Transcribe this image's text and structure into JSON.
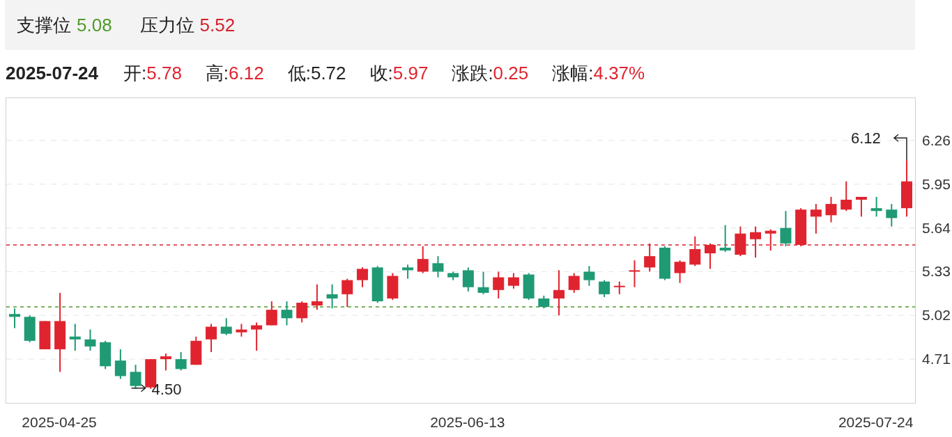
{
  "levels": [
    {
      "label": "支撑位",
      "value": "5.08",
      "color": "#4e9a2a"
    },
    {
      "label": "压力位",
      "value": "5.52",
      "color": "#d3202c"
    }
  ],
  "quote": {
    "date": "2025-07-24",
    "fields": [
      {
        "label": "开:",
        "value": "5.78",
        "color": "#e0242f"
      },
      {
        "label": "高:",
        "value": "6.12",
        "color": "#e0242f"
      },
      {
        "label": "低:",
        "value": "5.72",
        "color": "#222222"
      },
      {
        "label": "收:",
        "value": "5.97",
        "color": "#e0242f"
      },
      {
        "label": "涨跌:",
        "value": "0.25",
        "color": "#e0242f"
      },
      {
        "label": "涨幅:",
        "value": "4.37%",
        "color": "#e0242f"
      }
    ]
  },
  "chart": {
    "chart_data": {
      "type": "candlestick",
      "ohlc": [
        [
          5.03,
          5.07,
          4.93,
          5.01
        ],
        [
          5.01,
          5.02,
          4.83,
          4.84
        ],
        [
          4.78,
          4.98,
          4.78,
          4.98
        ],
        [
          4.78,
          5.18,
          4.62,
          4.98
        ],
        [
          4.87,
          4.96,
          4.77,
          4.85
        ],
        [
          4.85,
          4.92,
          4.77,
          4.8
        ],
        [
          4.83,
          4.84,
          4.64,
          4.66
        ],
        [
          4.7,
          4.78,
          4.57,
          4.59
        ],
        [
          4.62,
          4.67,
          4.5,
          4.52
        ],
        [
          4.51,
          4.71,
          4.5,
          4.71
        ],
        [
          4.71,
          4.75,
          4.63,
          4.73
        ],
        [
          4.71,
          4.76,
          4.63,
          4.64
        ],
        [
          4.67,
          4.87,
          4.67,
          4.84
        ],
        [
          4.85,
          4.96,
          4.76,
          4.94
        ],
        [
          4.94,
          5.0,
          4.88,
          4.89
        ],
        [
          4.9,
          4.96,
          4.87,
          4.92
        ],
        [
          4.92,
          4.97,
          4.77,
          4.95
        ],
        [
          4.95,
          5.12,
          4.95,
          5.06
        ],
        [
          5.06,
          5.12,
          4.95,
          5.0
        ],
        [
          5.0,
          5.12,
          4.97,
          5.11
        ],
        [
          5.09,
          5.24,
          5.06,
          5.12
        ],
        [
          5.17,
          5.24,
          5.07,
          5.14
        ],
        [
          5.17,
          5.28,
          5.08,
          5.27
        ],
        [
          5.27,
          5.36,
          5.22,
          5.35
        ],
        [
          5.36,
          5.37,
          5.11,
          5.12
        ],
        [
          5.14,
          5.32,
          5.13,
          5.3
        ],
        [
          5.36,
          5.38,
          5.28,
          5.34
        ],
        [
          5.33,
          5.51,
          5.32,
          5.42
        ],
        [
          5.39,
          5.44,
          5.29,
          5.33
        ],
        [
          5.32,
          5.33,
          5.27,
          5.29
        ],
        [
          5.34,
          5.36,
          5.19,
          5.22
        ],
        [
          5.22,
          5.33,
          5.17,
          5.18
        ],
        [
          5.2,
          5.33,
          5.14,
          5.29
        ],
        [
          5.23,
          5.32,
          5.21,
          5.29
        ],
        [
          5.31,
          5.32,
          5.13,
          5.14
        ],
        [
          5.14,
          5.16,
          5.07,
          5.08
        ],
        [
          5.14,
          5.34,
          5.02,
          5.2
        ],
        [
          5.2,
          5.32,
          5.18,
          5.3
        ],
        [
          5.33,
          5.37,
          5.23,
          5.27
        ],
        [
          5.26,
          5.27,
          5.15,
          5.17
        ],
        [
          5.22,
          5.26,
          5.17,
          5.23
        ],
        [
          5.33,
          5.41,
          5.22,
          5.34
        ],
        [
          5.36,
          5.53,
          5.33,
          5.44
        ],
        [
          5.5,
          5.51,
          5.27,
          5.28
        ],
        [
          5.32,
          5.41,
          5.25,
          5.4
        ],
        [
          5.38,
          5.58,
          5.37,
          5.49
        ],
        [
          5.46,
          5.53,
          5.35,
          5.52
        ],
        [
          5.5,
          5.66,
          5.47,
          5.48
        ],
        [
          5.45,
          5.65,
          5.44,
          5.6
        ],
        [
          5.56,
          5.65,
          5.43,
          5.61
        ],
        [
          5.6,
          5.63,
          5.48,
          5.62
        ],
        [
          5.64,
          5.76,
          5.51,
          5.53
        ],
        [
          5.52,
          5.78,
          5.51,
          5.77
        ],
        [
          5.72,
          5.81,
          5.6,
          5.77
        ],
        [
          5.73,
          5.86,
          5.68,
          5.81
        ],
        [
          5.77,
          5.97,
          5.76,
          5.84
        ],
        [
          5.84,
          5.86,
          5.72,
          5.86
        ],
        [
          5.78,
          5.86,
          5.72,
          5.76
        ],
        [
          5.77,
          5.81,
          5.65,
          5.71
        ],
        [
          5.78,
          6.12,
          5.72,
          5.97
        ]
      ],
      "ylim": [
        4.4,
        6.56
      ],
      "yticks": [
        6.26,
        5.95,
        5.64,
        5.33,
        5.02,
        4.71
      ],
      "grid": true,
      "ref_lines": [
        {
          "axis": "y",
          "value": 5.08,
          "color": "#4e9a2a"
        },
        {
          "axis": "y",
          "value": 5.52,
          "color": "#d3202c"
        }
      ],
      "categories": [
        null,
        null,
        null,
        "2025-04-25",
        null,
        null,
        null,
        null,
        null,
        null,
        null,
        null,
        null,
        null,
        null,
        null,
        null,
        null,
        null,
        null,
        null,
        null,
        null,
        null,
        null,
        null,
        null,
        null,
        null,
        null,
        "2025-06-13",
        null,
        null,
        null,
        null,
        null,
        null,
        null,
        null,
        null,
        null,
        null,
        null,
        null,
        null,
        null,
        null,
        null,
        null,
        null,
        null,
        null,
        null,
        null,
        null,
        null,
        null,
        "2025-07-24",
        null,
        null
      ],
      "annotations": [
        "6.12",
        "4.50"
      ]
    }
  }
}
